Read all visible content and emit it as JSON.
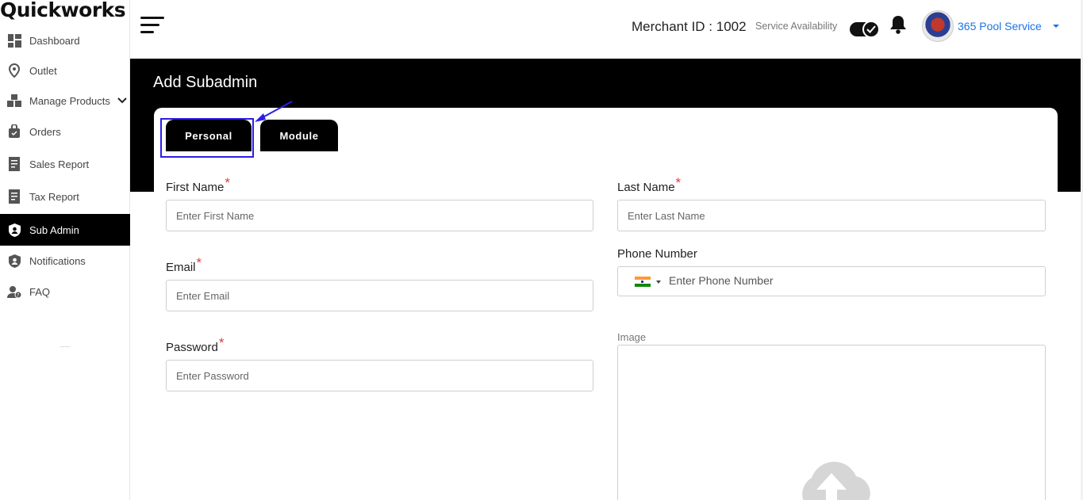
{
  "app": {
    "logo": "Quickworks"
  },
  "sidebar": {
    "items": [
      {
        "label": "Dashboard",
        "icon": "dashboard-icon"
      },
      {
        "label": "Outlet",
        "icon": "location-pin-icon"
      },
      {
        "label": "Manage Products",
        "icon": "boxes-icon",
        "has_submenu": true
      },
      {
        "label": "Orders",
        "icon": "shopping-bag-icon"
      },
      {
        "label": "Sales Report",
        "icon": "report-icon"
      },
      {
        "label": "Tax Report",
        "icon": "report-icon"
      },
      {
        "label": "Sub Admin",
        "icon": "shield-user-icon",
        "active": true
      },
      {
        "label": "Notifications",
        "icon": "shield-user-icon"
      },
      {
        "label": "FAQ",
        "icon": "faq-user-icon"
      }
    ]
  },
  "header": {
    "merchant_id": "Merchant ID : 1002",
    "service_availability_label": "Service Availability",
    "service_available": true,
    "user_name": "365 Pool Service"
  },
  "page": {
    "title": "Add Subadmin",
    "tabs": [
      {
        "label": "Personal",
        "active": true
      },
      {
        "label": "Module",
        "active": false
      }
    ]
  },
  "form": {
    "first_name": {
      "label": "First Name",
      "placeholder": "Enter First Name",
      "required": "*"
    },
    "last_name": {
      "label": "Last Name",
      "placeholder": "Enter Last Name",
      "required": "*"
    },
    "email": {
      "label": "Email",
      "placeholder": "Enter Email",
      "required": "*"
    },
    "phone": {
      "label": "Phone Number",
      "placeholder": "Enter Phone Number",
      "country": "IN"
    },
    "password": {
      "label": "Password",
      "placeholder": "Enter Password",
      "required": "*"
    },
    "image": {
      "label": "Image"
    }
  },
  "colors": {
    "accent_blue": "#1a73e8",
    "required_red": "#e53935",
    "highlight_box": "#2b1ee6",
    "banner": "#000000"
  }
}
